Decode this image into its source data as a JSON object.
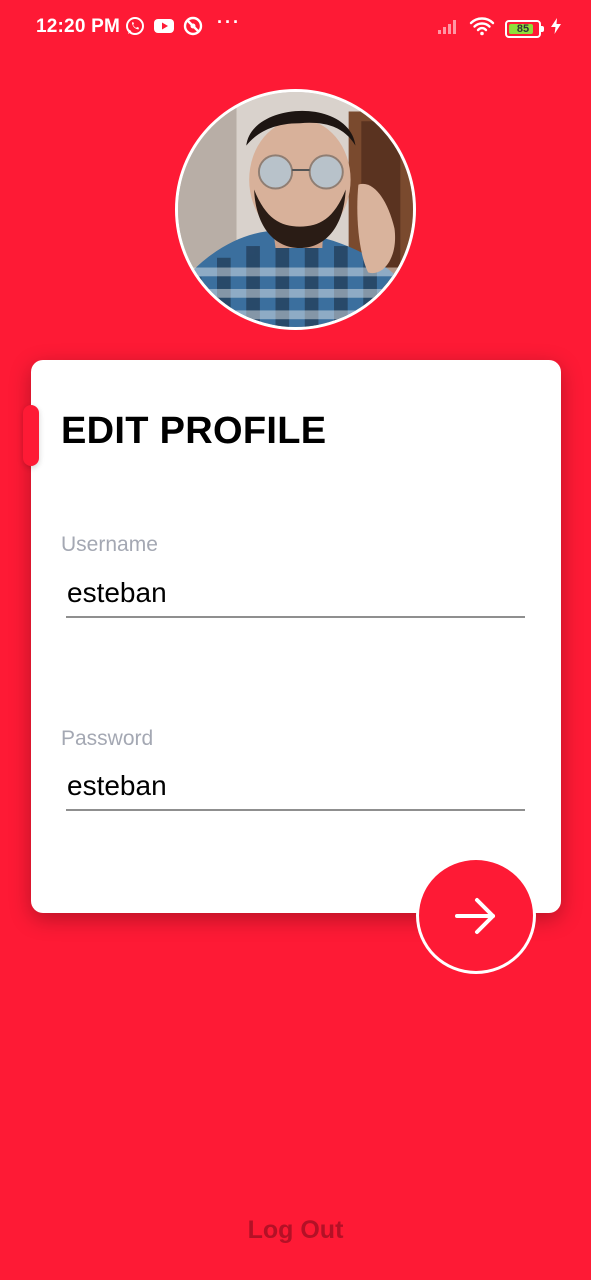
{
  "status_bar": {
    "time": "12:20 PM",
    "battery_level": "85",
    "battery_fraction": 0.85,
    "left_icons": [
      "whatsapp-icon",
      "youtube-icon",
      "no-disturb-icon",
      "more-dots-icon"
    ],
    "right_icons": [
      "signal-icon",
      "wifi-icon",
      "battery-icon",
      "charging-icon"
    ],
    "more_dots": "···"
  },
  "profile": {
    "avatar_icon": "profile-photo"
  },
  "card": {
    "title": "EDIT PROFILE",
    "username_label": "Username",
    "username_value": "esteban",
    "password_label": "Password",
    "password_value": "esteban"
  },
  "actions": {
    "submit_icon": "arrow-right-icon",
    "logout_label": "Log Out"
  },
  "colors": {
    "background": "#FE1A35",
    "card": "#FFFFFF",
    "label": "#A4A8B3",
    "logout": "#B31126",
    "battery_fill": "#8DDF3A"
  }
}
